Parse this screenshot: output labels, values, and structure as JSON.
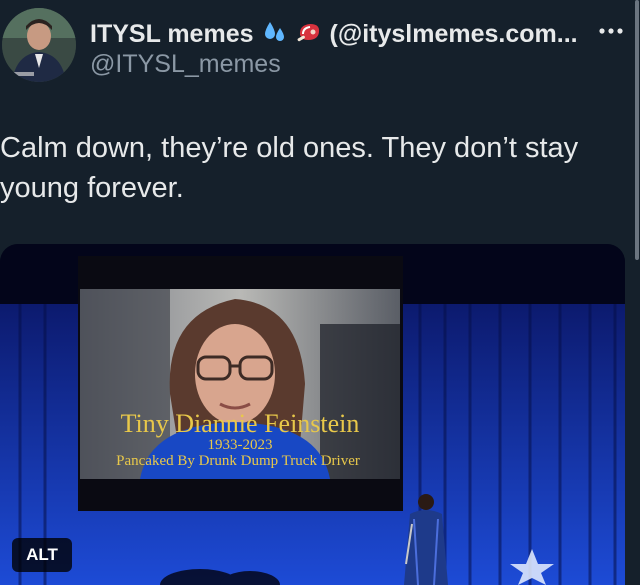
{
  "author": {
    "display_name": "ITYSL memes",
    "emoji_1": "sweat-droplets",
    "emoji_2": "steak",
    "title_handle": "(@ityslmemes.com...",
    "handle": "@ITYSL_memes"
  },
  "tweet": {
    "text_line1": "Calm down, they’re old ones. They don’t stay",
    "text_line2": "young forever."
  },
  "media": {
    "alt_label": "ALT",
    "caption_name": "Tiny Diannie Feinstein",
    "caption_years": "1933-2023",
    "caption_sub": "Pancaked By Drunk Dump Truck Driver"
  },
  "colors": {
    "background": "#15202b",
    "text": "#e7e9ea",
    "secondary": "#8b98a5",
    "caption": "#e8c84a"
  }
}
